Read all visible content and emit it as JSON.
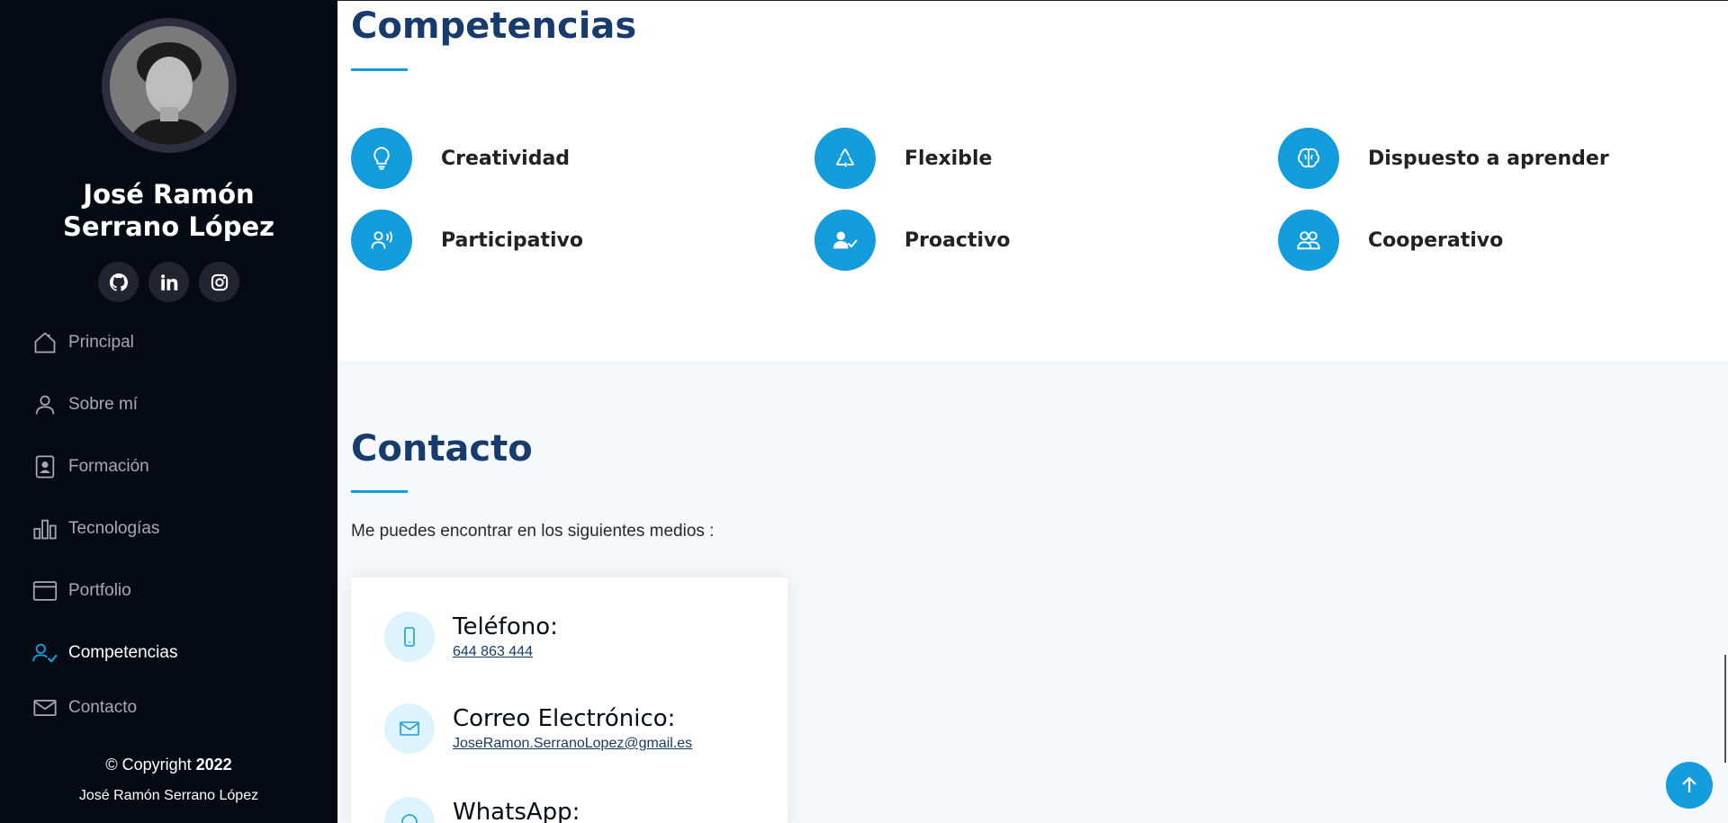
{
  "profile": {
    "name_line1": "José Ramón",
    "name_line2": "Serrano López"
  },
  "social": [
    "github-icon",
    "linkedin-icon",
    "instagram-icon"
  ],
  "nav": {
    "items": [
      {
        "label": "Principal",
        "icon": "home-icon"
      },
      {
        "label": "Sobre mí",
        "icon": "person-icon"
      },
      {
        "label": "Formación",
        "icon": "document-person-icon"
      },
      {
        "label": "Tecnologías",
        "icon": "bar-chart-icon"
      },
      {
        "label": "Portfolio",
        "icon": "window-icon"
      },
      {
        "label": "Competencias",
        "icon": "person-check-icon",
        "active": true
      },
      {
        "label": "Contacto",
        "icon": "envelope-icon"
      }
    ]
  },
  "footer": {
    "copyright_prefix": "© Copyright ",
    "year": "2022",
    "credits": "José Ramón Serrano López"
  },
  "skills": {
    "title": "Competencias",
    "items": [
      {
        "label": "Creatividad",
        "icon": "lightbulb-icon"
      },
      {
        "label": "Flexible",
        "icon": "recycle-icon"
      },
      {
        "label": "Dispuesto a aprender",
        "icon": "brain-icon"
      },
      {
        "label": "Participativo",
        "icon": "person-voice-icon"
      },
      {
        "label": "Proactivo",
        "icon": "person-check-icon"
      },
      {
        "label": "Cooperativo",
        "icon": "people-icon"
      }
    ]
  },
  "contact": {
    "title": "Contacto",
    "intro": "Me puedes encontrar en los siguientes medios :",
    "items": [
      {
        "label": "Teléfono:",
        "value": "644 863 444",
        "icon": "phone-icon"
      },
      {
        "label": "Correo Electrónico:",
        "value": "JoseRamon.SerranoLopez@gmail.es",
        "icon": "envelope-icon"
      },
      {
        "label": "WhatsApp:",
        "value": "",
        "icon": "whatsapp-icon"
      }
    ]
  },
  "colors": {
    "accent": "#149ddd",
    "sidebar_bg": "#040b14",
    "title": "#173b6c",
    "section_alt_bg": "#f5f8fd"
  }
}
